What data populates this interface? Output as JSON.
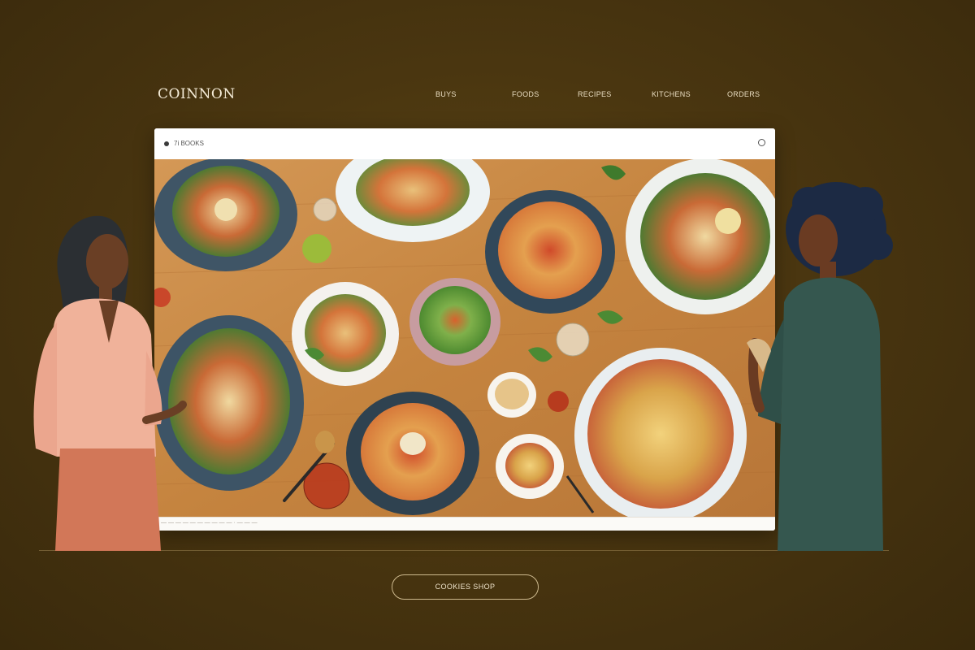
{
  "brand": {
    "logo_text": "COINNON"
  },
  "nav": {
    "items": [
      {
        "label": "BUYS"
      },
      {
        "label": "FOODS"
      },
      {
        "label": "RECIPES"
      },
      {
        "label": "KITCHENS"
      },
      {
        "label": "ORDERS"
      }
    ]
  },
  "window": {
    "titlebar_text": "7i   BOOKS",
    "status_text": "— — — — — — — — — —   ·   — — —"
  },
  "cta": {
    "label": "COOKIES SHOP"
  },
  "colors": {
    "background": "#4a3610",
    "table_wood": "#c98a4a",
    "accent_outline": "#cdb98e"
  }
}
